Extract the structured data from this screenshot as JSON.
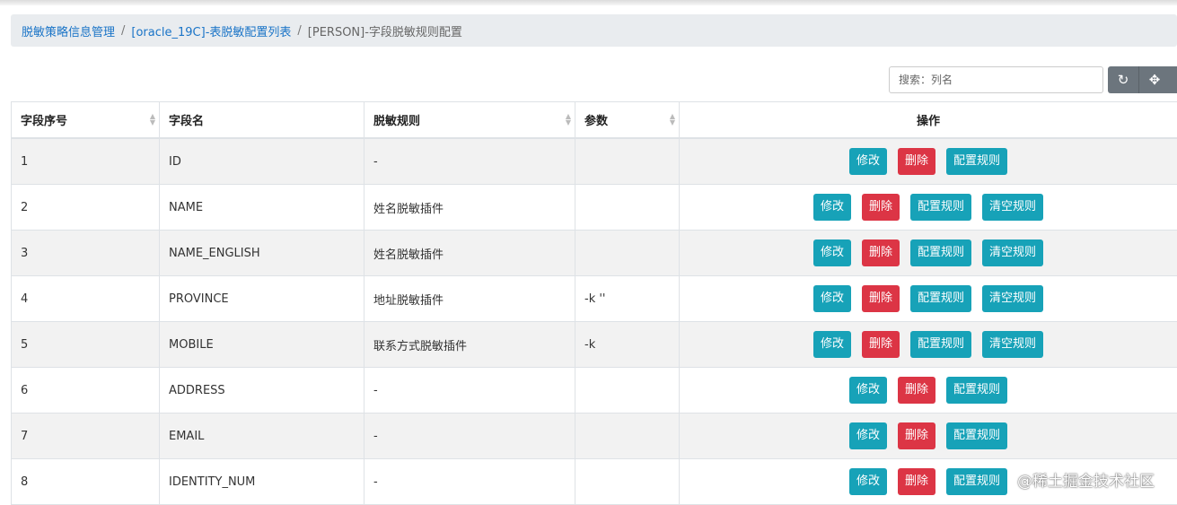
{
  "breadcrumb": {
    "item1": "脱敏策略信息管理",
    "item2": "[oracle_19C]-表脱敏配置列表",
    "current": "[PERSON]-字段脱敏规则配置",
    "separator": "/"
  },
  "search": {
    "placeholder": "搜索：列名",
    "value": ""
  },
  "toolbar": {
    "refresh_icon": "↻",
    "move_icon": "✥"
  },
  "table": {
    "headers": {
      "index": "字段序号",
      "name": "字段名",
      "rule": "脱敏规则",
      "param": "参数",
      "ops": "操作"
    },
    "rows": [
      {
        "index": "1",
        "name": "ID",
        "rule": "-",
        "param": "",
        "has_clear": false
      },
      {
        "index": "2",
        "name": "NAME",
        "rule": "姓名脱敏插件",
        "param": "",
        "has_clear": true
      },
      {
        "index": "3",
        "name": "NAME_ENGLISH",
        "rule": "姓名脱敏插件",
        "param": "",
        "has_clear": true
      },
      {
        "index": "4",
        "name": "PROVINCE",
        "rule": "地址脱敏插件",
        "param": "-k ''",
        "has_clear": true
      },
      {
        "index": "5",
        "name": "MOBILE",
        "rule": "联系方式脱敏插件",
        "param": "-k",
        "has_clear": true
      },
      {
        "index": "6",
        "name": "ADDRESS",
        "rule": "-",
        "param": "",
        "has_clear": false
      },
      {
        "index": "7",
        "name": "EMAIL",
        "rule": "-",
        "param": "",
        "has_clear": false
      },
      {
        "index": "8",
        "name": "IDENTITY_NUM",
        "rule": "-",
        "param": "",
        "has_clear": false
      }
    ]
  },
  "actions": {
    "edit": "修改",
    "delete": "删除",
    "config": "配置规则",
    "clear": "清空规则"
  },
  "watermark": "@稀土掘金技术社区",
  "colors": {
    "info": "#17a2b8",
    "danger": "#dc3545",
    "link": "#1a74c7",
    "toolbar": "#6c757d"
  }
}
